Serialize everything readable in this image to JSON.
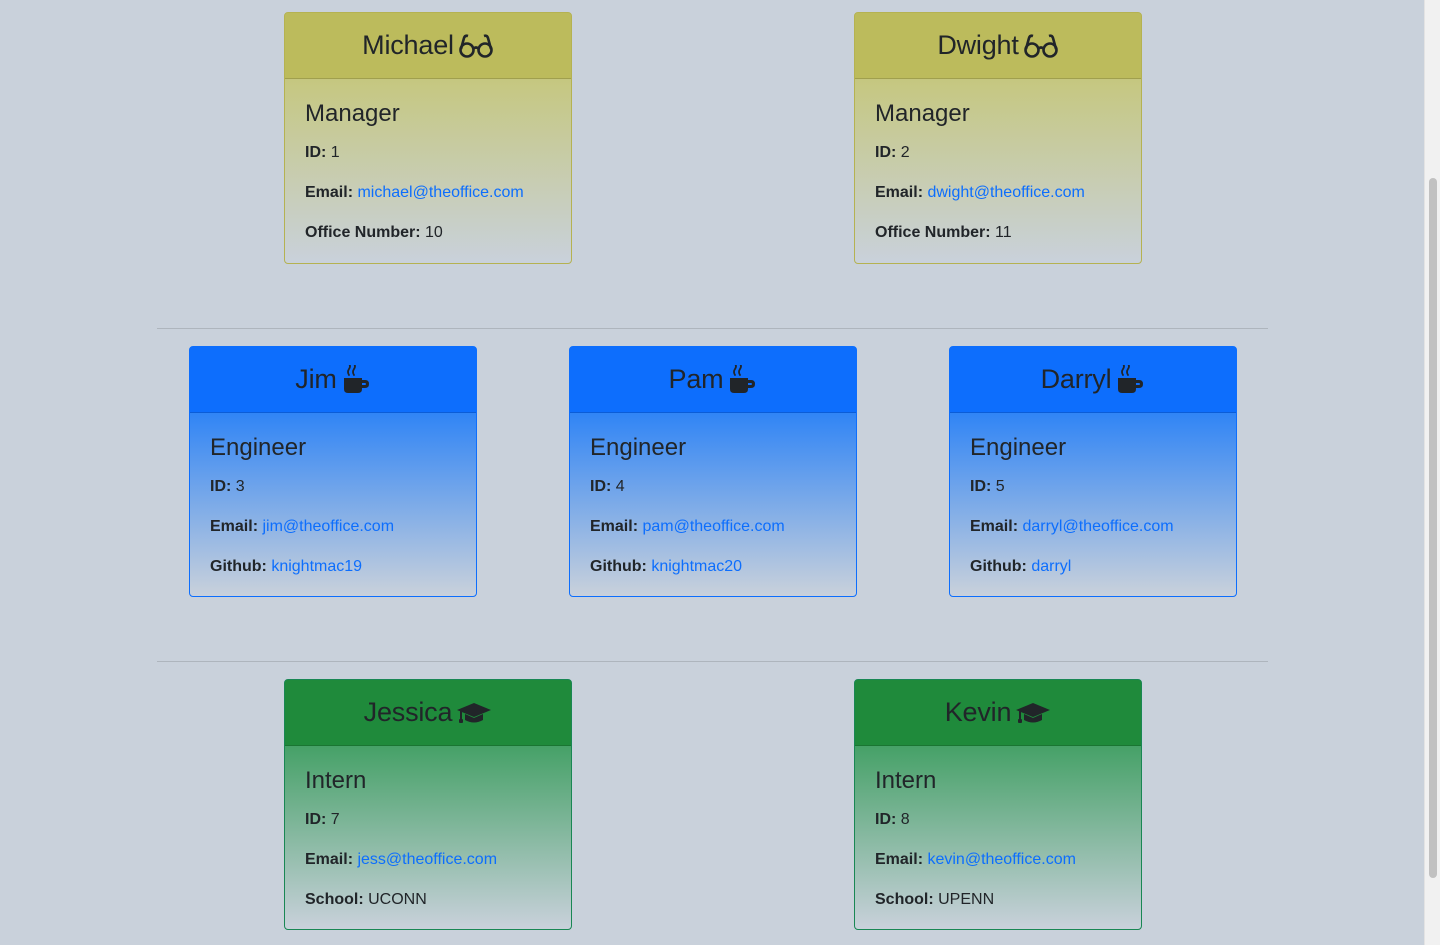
{
  "managers": [
    {
      "name": "Michael",
      "role": "Manager",
      "id_label": "ID:",
      "id": "1",
      "email_label": "Email:",
      "email": "michael@theoffice.com",
      "extra_label": "Office Number:",
      "extra": "10",
      "icon": "glasses-icon"
    },
    {
      "name": "Dwight",
      "role": "Manager",
      "id_label": "ID:",
      "id": "2",
      "email_label": "Email:",
      "email": "dwight@theoffice.com",
      "extra_label": "Office Number:",
      "extra": "11",
      "icon": "glasses-icon"
    }
  ],
  "engineers": [
    {
      "name": "Jim",
      "role": "Engineer",
      "id_label": "ID:",
      "id": "3",
      "email_label": "Email:",
      "email": "jim@theoffice.com",
      "extra_label": "Github:",
      "extra": "knightmac19",
      "icon": "mug-icon"
    },
    {
      "name": "Pam",
      "role": "Engineer",
      "id_label": "ID:",
      "id": "4",
      "email_label": "Email:",
      "email": "pam@theoffice.com",
      "extra_label": "Github:",
      "extra": "knightmac20",
      "icon": "mug-icon"
    },
    {
      "name": "Darryl",
      "role": "Engineer",
      "id_label": "ID:",
      "id": "5",
      "email_label": "Email:",
      "email": "darryl@theoffice.com",
      "extra_label": "Github:",
      "extra": "darryl",
      "icon": "mug-icon"
    }
  ],
  "interns": [
    {
      "name": "Jessica",
      "role": "Intern",
      "id_label": "ID:",
      "id": "7",
      "email_label": "Email:",
      "email": "jess@theoffice.com",
      "extra_label": "School:",
      "extra": "UCONN",
      "icon": "graduation-cap-icon"
    },
    {
      "name": "Kevin",
      "role": "Intern",
      "id_label": "ID:",
      "id": "8",
      "email_label": "Email:",
      "email": "kevin@theoffice.com",
      "extra_label": "School:",
      "extra": "UPENN",
      "icon": "graduation-cap-icon"
    }
  ],
  "colors": {
    "background": "#c9d1db",
    "manager": "#bcbb5c",
    "engineer": "#0d6efd",
    "intern": "#1f8a3b",
    "link": "#0d6efd"
  }
}
